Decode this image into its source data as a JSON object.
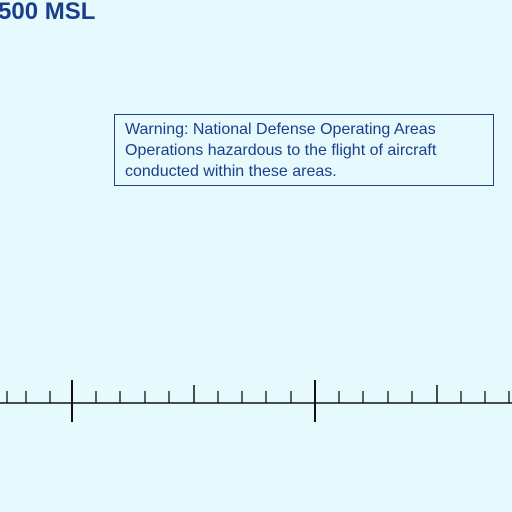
{
  "altitude_label": "500 MSL",
  "warning": {
    "lines": [
      "Warning: National Defense Operating Areas",
      "Operations hazardous to the flight of aircraft",
      "conducted within these areas."
    ]
  },
  "colors": {
    "background": "#E6FAFD",
    "text": "#1A3E8A",
    "box_border": "#1E3F8E",
    "scale_line": "#111111"
  }
}
